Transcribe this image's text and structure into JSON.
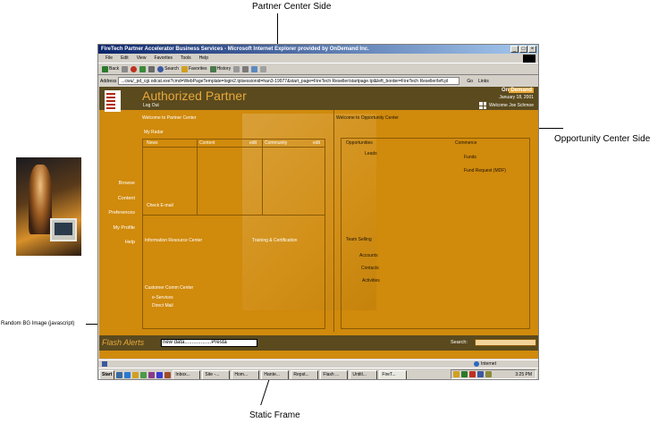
{
  "annotations": {
    "top": "Partner Center Side",
    "right": "Opportunity Center Side",
    "left": "Random BG Image (javascript)",
    "bottom": "Static Frame"
  },
  "browser": {
    "title": "FireTech Partner Accelerator Business Services - Microsoft Internet Explorer provided by OnDemand Inc.",
    "menu": [
      "File",
      "Edit",
      "View",
      "Favorites",
      "Tools",
      "Help"
    ],
    "toolbar": {
      "back": "Back",
      "search": "Search",
      "favorites": "Favorites",
      "history": "History"
    },
    "address_label": "Address",
    "address_value": "...cwu/_pd_cgi.odcat.exe?cmd=WebPageTemplate=login2.tplsessionid=han3-19977&start_page=FireTech Reseller/startpage.tpl&left_border=FireTech Reseller/left.pl",
    "go_label": "Go",
    "links_label": "Links",
    "status_zone": "Internet"
  },
  "header": {
    "brand": "Authorized Partner",
    "logout": "Log Out",
    "ondemand_a": "On",
    "ondemand_b": "Demand",
    "date": "January 18, 2001",
    "welcome_user": "Welcome Joe Schmoe"
  },
  "partner": {
    "welcome": "Welcome to Partner Center",
    "my_radar": "My Radar",
    "news": "News",
    "content": "Content",
    "community": "Community",
    "edit": "edit",
    "check_email": "Check E-mail",
    "info_center": "Information Resource Center",
    "training": "Training & Certification",
    "customer_comm": "Customer Comm Center",
    "eservices": "e-Services",
    "direct_mail": "Direct Mail"
  },
  "nav": [
    "Browse",
    "Content",
    "Preferences",
    "My Profile",
    "Help"
  ],
  "opportunity": {
    "welcome": "Welcome to Opportunity Center",
    "opportunities": "Opportunities",
    "leads": "Leads",
    "commerce": "Commerce",
    "funds": "Funds",
    "fund_request": "Fund Request (MDF)",
    "team_selling": "Team Selling",
    "accounts": "Accounts",
    "contacts": "Contacts",
    "activities": "Activities"
  },
  "flash": {
    "label": "Flash Alerts",
    "ticker": "new data..................Presta",
    "search_label": "Search:"
  },
  "taskbar": {
    "start": "Start",
    "tasks": [
      "Inbox...",
      "Site -...",
      "Hom...",
      "Hante...",
      "Repst...",
      "Flash ...",
      "Untitl...",
      "FireT..."
    ],
    "clock": "3:25 PM"
  },
  "colors": {
    "page_orange": "#d08a0c",
    "header_brown": "#5a4a1e",
    "brand_gold": "#e8a83a"
  }
}
